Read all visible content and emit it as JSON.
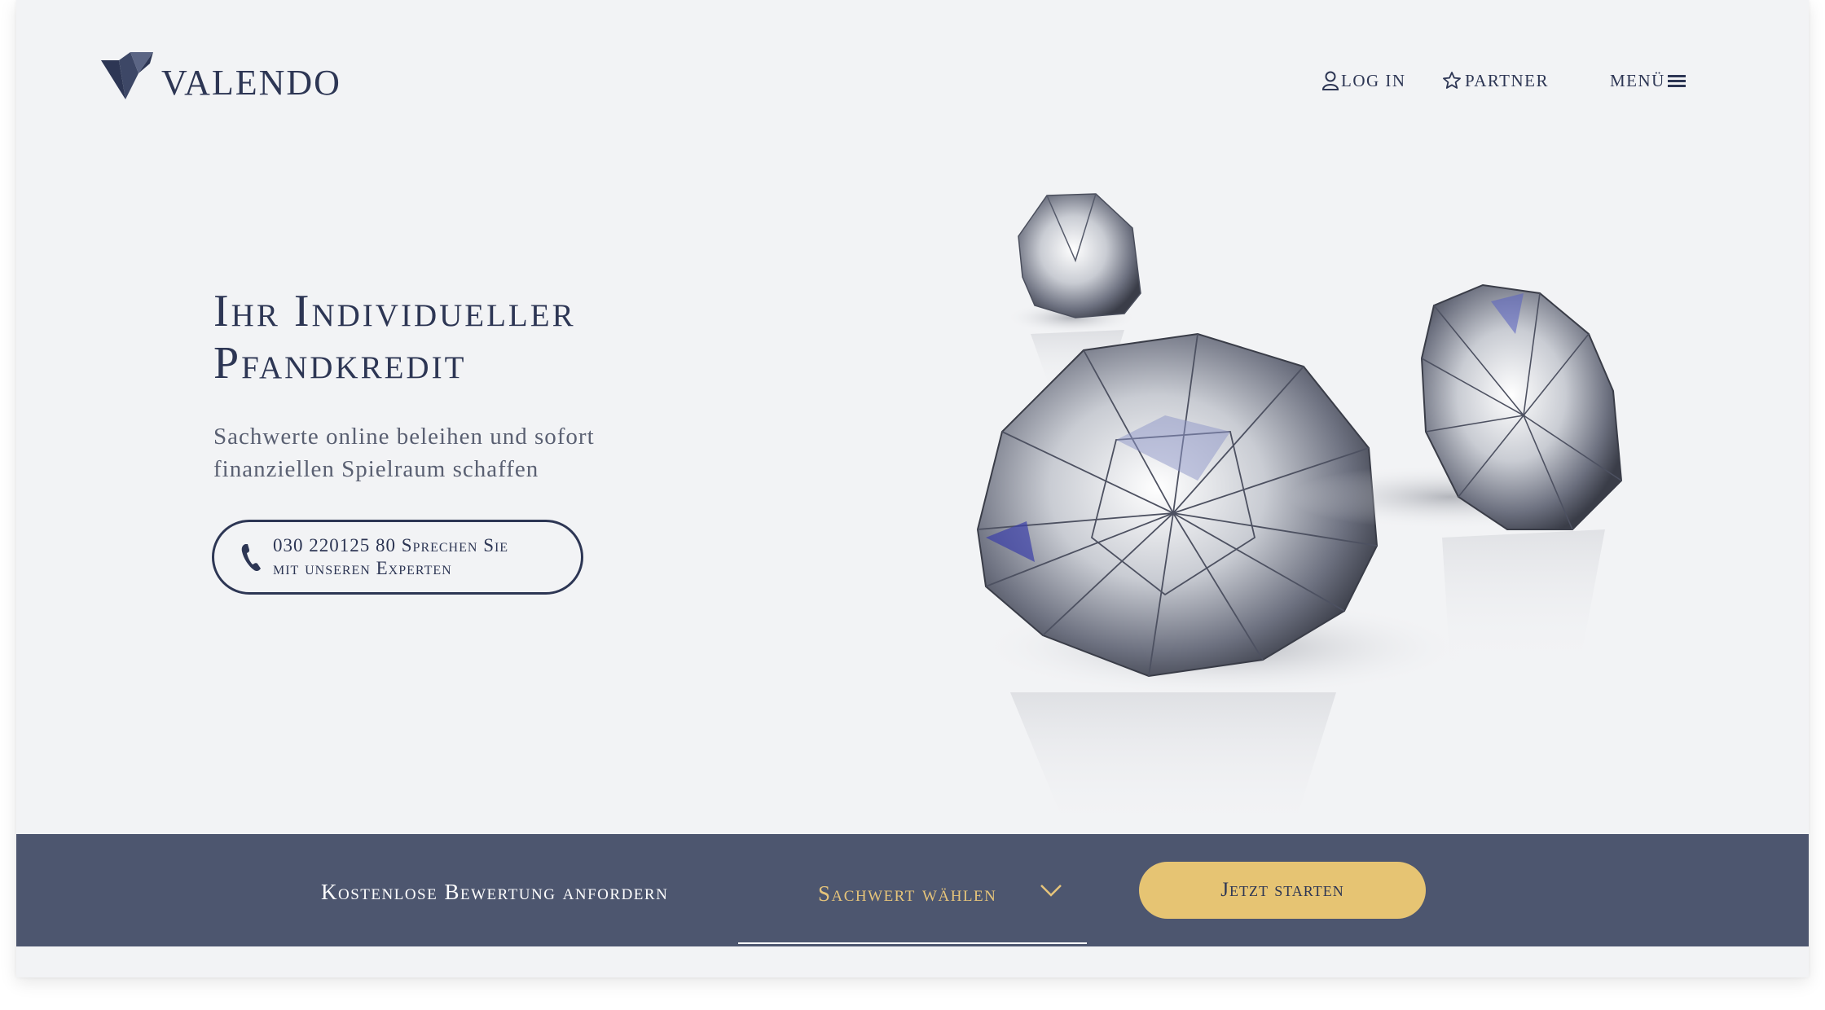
{
  "header": {
    "logo_text": "VALENDO",
    "nav": {
      "login_label": "LOG IN",
      "partner_label": "PARTNER",
      "menu_label": "MENÜ"
    }
  },
  "hero": {
    "title_line1": "Ihr Individueller",
    "title_line2": "Pfandkredit",
    "subtitle_line1": "Sachwerte online beleihen und sofort",
    "subtitle_line2": "finanziellen Spielraum schaffen",
    "phone_line1": "030 220125 80 Sprechen Sie",
    "phone_line2": "mit unseren Experten"
  },
  "valuation_bar": {
    "label": "Kostenlose Bewertung anfordern",
    "select_value": "Sachwert wählen",
    "start_button": "Jetzt starten"
  },
  "colors": {
    "navy": "#2d3654",
    "bar_bg": "#4d566f",
    "gold": "#e6c473",
    "page_bg": "#f2f3f5"
  },
  "icons": [
    "valendo-logo-icon",
    "user-icon",
    "star-icon",
    "hamburger-icon",
    "phone-icon",
    "chevron-down-icon"
  ]
}
